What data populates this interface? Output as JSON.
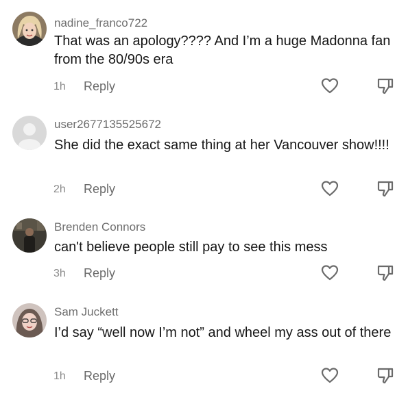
{
  "comments": [
    {
      "username": "nadine_franco722",
      "text": "That was an apology???? And I’m a huge Madonna fan from the 80/90s era",
      "time": "1h",
      "reply_label": "Reply",
      "avatar_icon": "user-photo-avatar-icon"
    },
    {
      "username": "user2677135525672",
      "text": "She did the exact same thing at her Vancouver show!!!!",
      "time": "2h",
      "reply_label": "Reply",
      "avatar_icon": "default-avatar-icon"
    },
    {
      "username": "Brenden Connors",
      "text": "can't believe people still pay to see this mess",
      "time": "3h",
      "reply_label": "Reply",
      "avatar_icon": "user-photo-avatar-icon"
    },
    {
      "username": "Sam Juckett",
      "text": "I’d say “well now I’m not” and wheel my ass out of there",
      "time": "1h",
      "reply_label": "Reply",
      "avatar_icon": "user-photo-avatar-icon"
    }
  ],
  "colors": {
    "username": "#6e6e6e",
    "text": "#161616",
    "meta": "#8a8a8a",
    "icon_stroke": "#6a6a6a",
    "background": "#ffffff"
  },
  "icons": {
    "like": "heart-outline-icon",
    "dislike": "thumbs-down-outline-icon"
  }
}
